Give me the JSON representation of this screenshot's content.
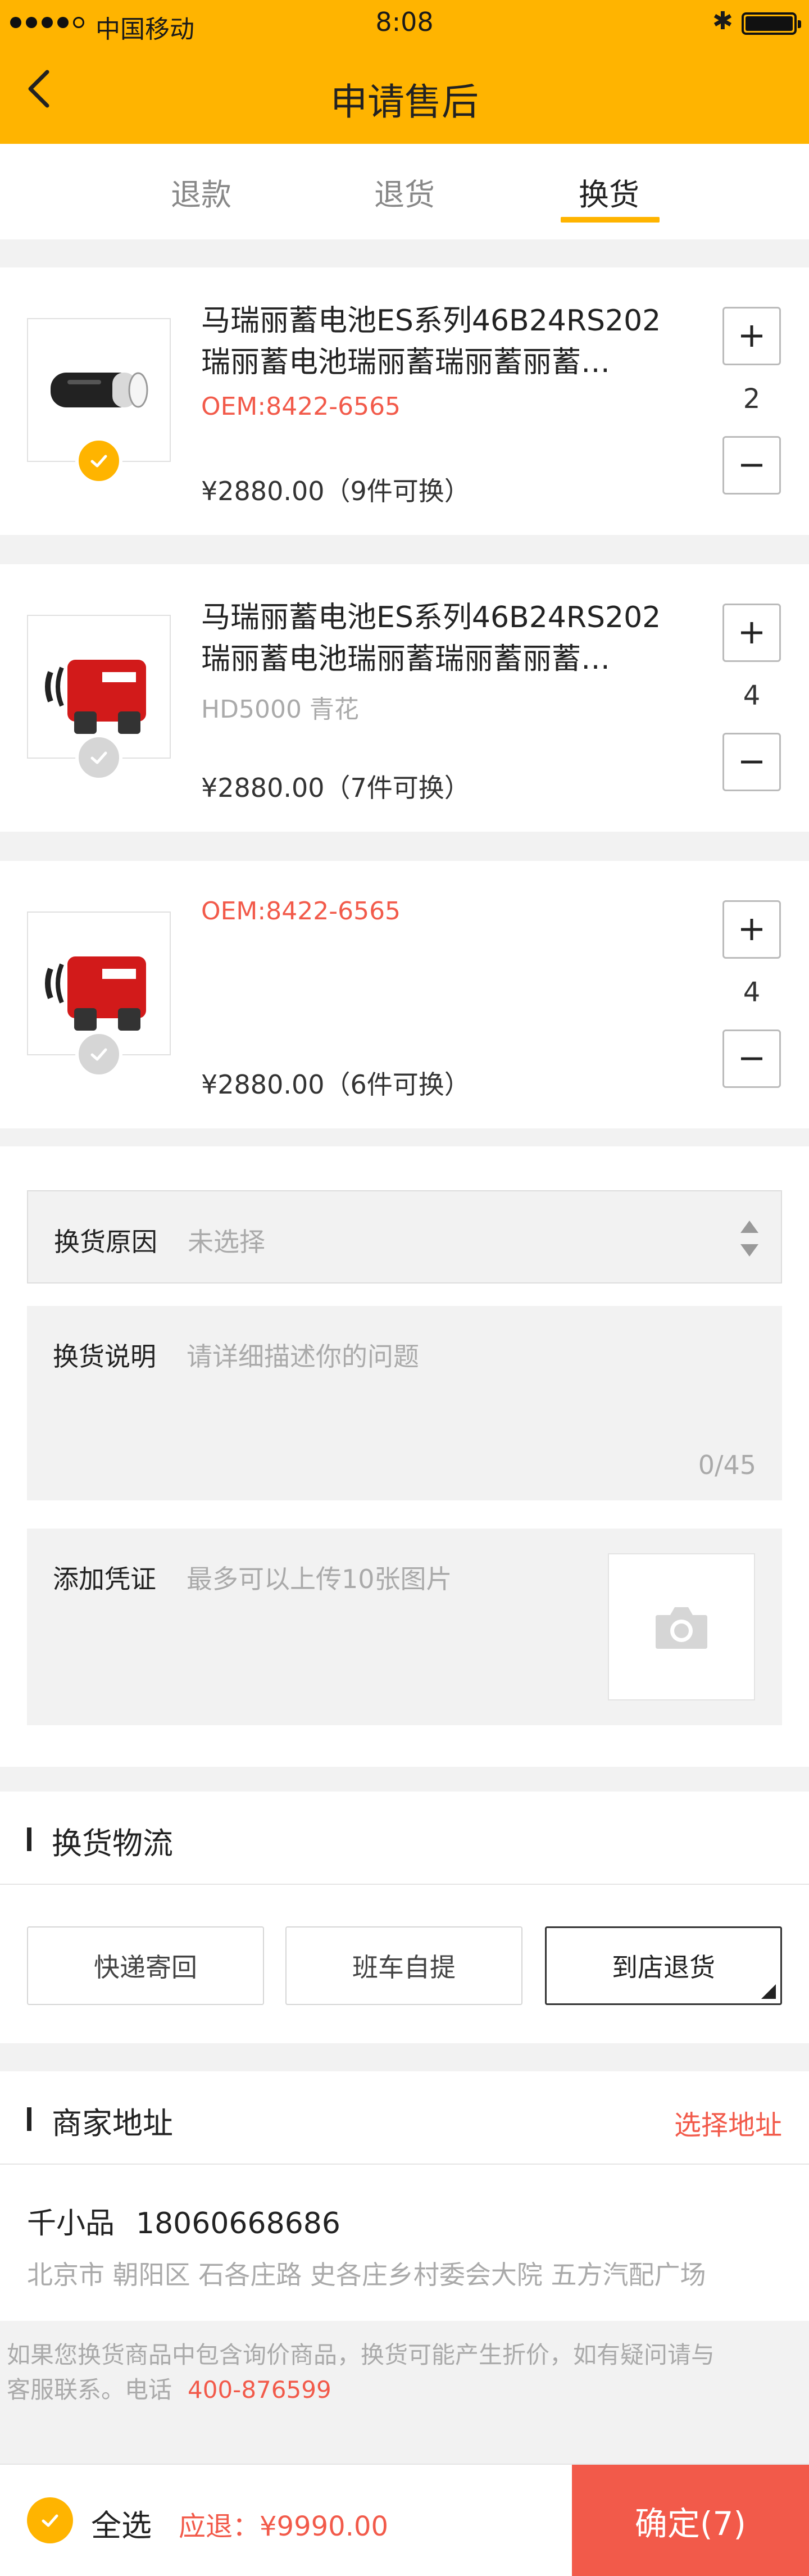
{
  "status_bar": {
    "carrier": "中国移动",
    "time": "8:08"
  },
  "header": {
    "title": "申请售后"
  },
  "tabs": [
    {
      "label": "退款"
    },
    {
      "label": "退货"
    },
    {
      "label": "换货"
    }
  ],
  "active_tab": "换货",
  "products": [
    {
      "name_line1": "马瑞丽蓄电池ES系列46B24RS202",
      "name_line2": "瑞丽蓄电池瑞丽蓄瑞丽蓄丽蓄…",
      "oem": "OEM:8422-6565",
      "price": "¥2880.00（9件可换）",
      "quantity": "2",
      "selected": true
    },
    {
      "name_line1": "马瑞丽蓄电池ES系列46B24RS202",
      "name_line2": "瑞丽蓄电池瑞丽蓄瑞丽蓄丽蓄…",
      "spec": "HD5000 青花",
      "price": "¥2880.00（7件可换）",
      "quantity": "4",
      "selected": false
    },
    {
      "oem": "OEM:8422-6565",
      "price": "¥2880.00（6件可换）",
      "quantity": "4",
      "selected": false
    }
  ],
  "form": {
    "reason": {
      "label": "换货原因",
      "value": "未选择"
    },
    "description": {
      "label": "换货说明",
      "placeholder": "请详细描述你的问题",
      "counter": "0/45"
    },
    "proof": {
      "label": "添加凭证",
      "hint": "最多可以上传10张图片"
    }
  },
  "logistics": {
    "title": "换货物流",
    "options": [
      "快递寄回",
      "班车自提",
      "到店退货"
    ],
    "selected": "到店退货"
  },
  "merchant_address": {
    "title": "商家地址",
    "action": "选择地址",
    "name": "千小品",
    "phone": "18060668686",
    "address": "北京市 朝阳区 石各庄路 史各庄乡村委会大院 五方汽配广场"
  },
  "notice": {
    "text_line1": "如果您换货商品中包含询价商品，换货可能产生折价，如有疑问请与",
    "text_line2": "客服联系。电话",
    "phone": "400-876599"
  },
  "bottom_bar": {
    "select_all": "全选",
    "refund": "应退：¥9990.00",
    "confirm": "确定(7)"
  },
  "colors": {
    "accent": "#ffb400",
    "price_red": "#f25a4a"
  }
}
